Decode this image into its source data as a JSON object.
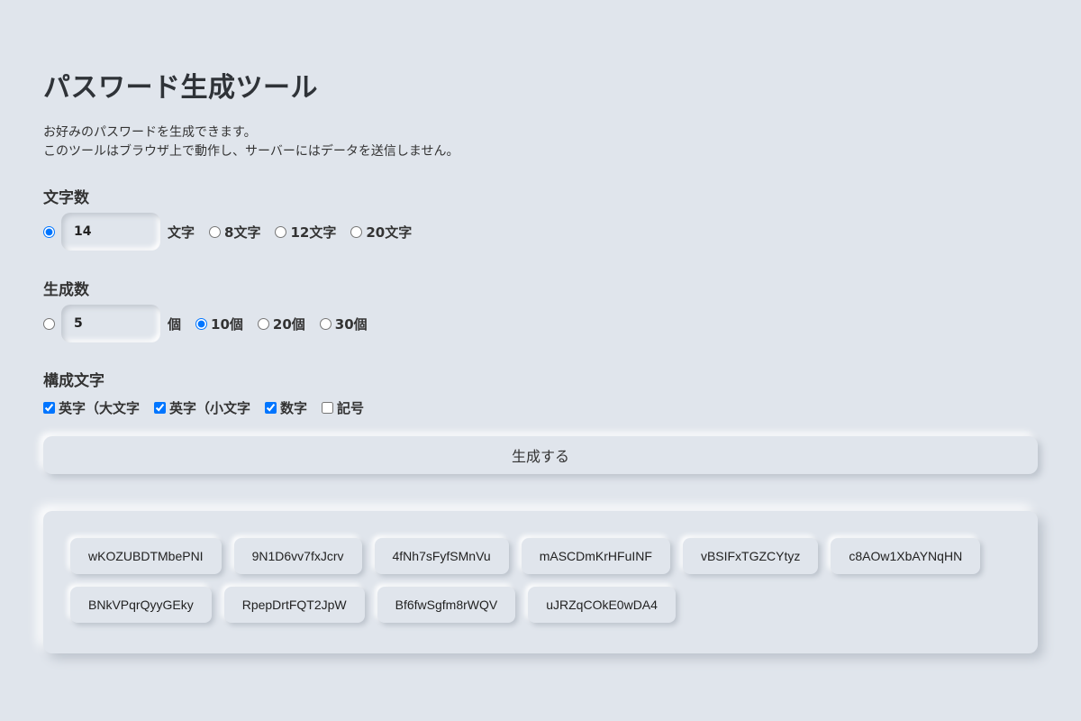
{
  "header": {
    "title": "パスワード生成ツール",
    "desc_line1": "お好みのパスワードを生成できます。",
    "desc_line2": "このツールはブラウザ上で動作し、サーバーにはデータを送信しません。"
  },
  "length": {
    "title": "文字数",
    "custom_value": "14",
    "unit": "文字",
    "selected": "custom",
    "options": [
      "8文字",
      "12文字",
      "20文字"
    ]
  },
  "count": {
    "title": "生成数",
    "custom_value": "5",
    "unit": "個",
    "selected": "10個",
    "options": [
      "10個",
      "20個",
      "30個"
    ]
  },
  "chars": {
    "title": "構成文字",
    "options": [
      {
        "label": "英字（大文字",
        "checked": true
      },
      {
        "label": "英字（小文字",
        "checked": true
      },
      {
        "label": "数字",
        "checked": true
      },
      {
        "label": "記号",
        "checked": false
      }
    ]
  },
  "generate_label": "生成する",
  "passwords": [
    "wKOZUBDTMbePNI",
    "9N1D6vv7fxJcrv",
    "4fNh7sFyfSMnVu",
    "mASCDmKrHFuINF",
    "vBSIFxTGZCYtyz",
    "c8AOw1XbAYNqHN",
    "BNkVPqrQyyGEky",
    "RpepDrtFQT2JpW",
    "Bf6fwSgfm8rWQV",
    "uJRZqCOkE0wDA4"
  ]
}
